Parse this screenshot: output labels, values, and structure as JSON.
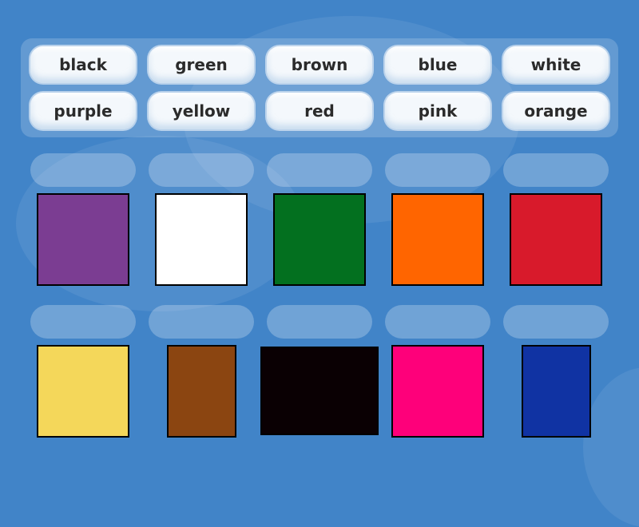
{
  "word_bank": [
    {
      "label": "black"
    },
    {
      "label": "green"
    },
    {
      "label": "brown"
    },
    {
      "label": "blue"
    },
    {
      "label": "white"
    },
    {
      "label": "purple"
    },
    {
      "label": "yellow"
    },
    {
      "label": "red"
    },
    {
      "label": "pink"
    },
    {
      "label": "orange"
    }
  ],
  "swatches": [
    {
      "color": "#7b3d92",
      "name": "purple"
    },
    {
      "color": "#ffffff",
      "name": "white"
    },
    {
      "color": "#03701f",
      "name": "green"
    },
    {
      "color": "#ff6500",
      "name": "orange"
    },
    {
      "color": "#d81a2b",
      "name": "red"
    },
    {
      "color": "#f4d75a",
      "name": "yellow"
    },
    {
      "color": "#8b4511",
      "name": "brown"
    },
    {
      "color": "#0a0003",
      "name": "black"
    },
    {
      "color": "#fe007a",
      "name": "pink"
    },
    {
      "color": "#1033a3",
      "name": "blue"
    }
  ],
  "theme": {
    "background": "#4184c8"
  }
}
